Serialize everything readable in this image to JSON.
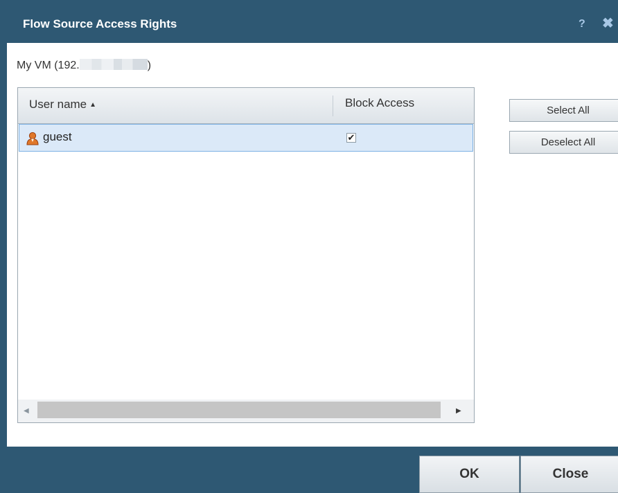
{
  "dialog": {
    "title": "Flow Source Access Rights",
    "help_icon": "?",
    "close_icon": "✖"
  },
  "source": {
    "label_prefix": "My VM (192.",
    "label_suffix": ")"
  },
  "grid": {
    "columns": [
      {
        "label": "User name",
        "sort": "ascending",
        "sort_glyph": "▲"
      },
      {
        "label": "Block Access"
      }
    ],
    "rows": [
      {
        "user": "guest",
        "icon": "user-icon",
        "block_access": true,
        "checkmark": "✔",
        "selected": true
      }
    ],
    "scroll_left_glyph": "◀",
    "scroll_right_glyph": "▶"
  },
  "side_buttons": {
    "select_all": "Select All",
    "deselect_all": "Deselect All"
  },
  "footer": {
    "ok": "OK",
    "close": "Close"
  },
  "colors": {
    "titlebar": "#2e5873",
    "row_selected": "#dbe9f8",
    "row_border": "#7db2e4"
  }
}
